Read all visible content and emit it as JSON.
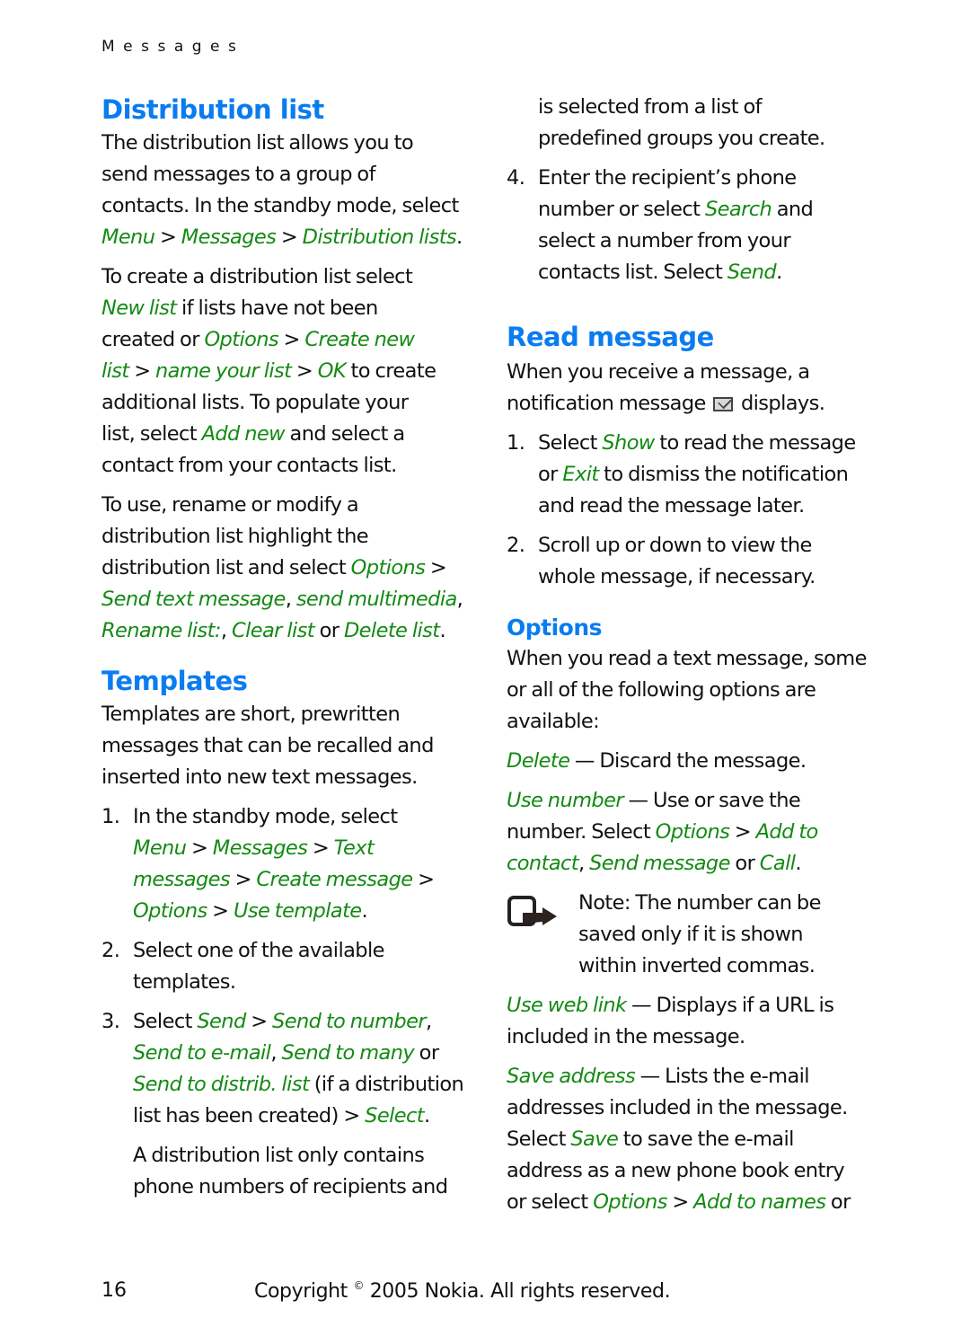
{
  "running_head": "Messages",
  "left_column": {
    "distribution_list": {
      "heading": "Distribution list",
      "para1": [
        [
          {
            "t": "The distribution list allows you to"
          }
        ],
        [
          {
            "t": "send messages to a group of"
          }
        ],
        [
          {
            "t": "contacts. In the standby mode, select"
          }
        ],
        [
          {
            "t": "Menu",
            "g": true
          },
          {
            "t": " > "
          },
          {
            "t": "Messages",
            "g": true
          },
          {
            "t": " > "
          },
          {
            "t": "Distribution lists",
            "g": true
          },
          {
            "t": "."
          }
        ]
      ],
      "para2": [
        [
          {
            "t": "To create a distribution list select"
          }
        ],
        [
          {
            "t": "New list",
            "g": true
          },
          {
            "t": " if lists have not been"
          }
        ],
        [
          {
            "t": "created or "
          },
          {
            "t": "Options",
            "g": true
          },
          {
            "t": " > "
          },
          {
            "t": "Create new",
            "g": true
          }
        ],
        [
          {
            "t": "list",
            "g": true
          },
          {
            "t": " > "
          },
          {
            "t": "name your list",
            "g": true
          },
          {
            "t": " > "
          },
          {
            "t": "OK",
            "g": true
          },
          {
            "t": " to create"
          }
        ],
        [
          {
            "t": "additional lists. To populate your"
          }
        ],
        [
          {
            "t": "list, select "
          },
          {
            "t": "Add new",
            "g": true
          },
          {
            "t": " and select a"
          }
        ],
        [
          {
            "t": "contact from your contacts list."
          }
        ]
      ],
      "para3": [
        [
          {
            "t": "To use, rename or modify a"
          }
        ],
        [
          {
            "t": "distribution list highlight the"
          }
        ],
        [
          {
            "t": "distribution list and select "
          },
          {
            "t": "Options",
            "g": true
          },
          {
            "t": " >"
          }
        ],
        [
          {
            "t": "Send text message",
            "g": true
          },
          {
            "t": ", "
          },
          {
            "t": "send multimedia",
            "g": true
          },
          {
            "t": ","
          }
        ],
        [
          {
            "t": "Rename list:",
            "g": true
          },
          {
            "t": ", "
          },
          {
            "t": "Clear list",
            "g": true
          },
          {
            "t": " or "
          },
          {
            "t": "Delete list",
            "g": true
          },
          {
            "t": "."
          }
        ]
      ]
    },
    "templates": {
      "heading": "Templates",
      "intro": [
        [
          {
            "t": "Templates are short, prewritten"
          }
        ],
        [
          {
            "t": "messages that can be recalled and"
          }
        ],
        [
          {
            "t": "inserted into new text messages."
          }
        ]
      ],
      "steps": [
        {
          "num": "1.",
          "lines": [
            [
              {
                "t": "In the standby mode, select"
              }
            ],
            [
              {
                "t": "Menu",
                "g": true
              },
              {
                "t": " > "
              },
              {
                "t": "Messages",
                "g": true
              },
              {
                "t": " > "
              },
              {
                "t": "Text",
                "g": true
              }
            ],
            [
              {
                "t": "messages",
                "g": true
              },
              {
                "t": " > "
              },
              {
                "t": "Create message",
                "g": true
              },
              {
                "t": " >"
              }
            ],
            [
              {
                "t": "Options",
                "g": true
              },
              {
                "t": " > "
              },
              {
                "t": "Use template",
                "g": true
              },
              {
                "t": "."
              }
            ]
          ]
        },
        {
          "num": "2.",
          "lines": [
            [
              {
                "t": "Select one of the available"
              }
            ],
            [
              {
                "t": "templates."
              }
            ]
          ]
        },
        {
          "num": "3.",
          "lines": [
            [
              {
                "t": "Select "
              },
              {
                "t": "Send",
                "g": true
              },
              {
                "t": " > "
              },
              {
                "t": "Send to number",
                "g": true
              },
              {
                "t": ","
              }
            ],
            [
              {
                "t": "Send to e-mail",
                "g": true
              },
              {
                "t": ", "
              },
              {
                "t": "Send to many",
                "g": true
              },
              {
                "t": " or"
              }
            ],
            [
              {
                "t": "Send to distrib. list",
                "g": true
              },
              {
                "t": " (if a distribution"
              }
            ],
            [
              {
                "t": "list has been created) > "
              },
              {
                "t": "Select",
                "g": true
              },
              {
                "t": "."
              }
            ]
          ],
          "extra": [
            [
              {
                "t": "A distribution list only contains"
              }
            ],
            [
              {
                "t": "phone numbers of recipients and"
              }
            ]
          ]
        }
      ]
    }
  },
  "right_column": {
    "continuation": [
      [
        {
          "t": "is selected from a list of"
        }
      ],
      [
        {
          "t": "predefined groups you create."
        }
      ]
    ],
    "step4": {
      "num": "4.",
      "lines": [
        [
          {
            "t": "Enter the recipient’s phone"
          }
        ],
        [
          {
            "t": "number or select "
          },
          {
            "t": "Search",
            "g": true
          },
          {
            "t": " and"
          }
        ],
        [
          {
            "t": "select a number from your"
          }
        ],
        [
          {
            "t": "contacts list. Select "
          },
          {
            "t": "Send",
            "g": true
          },
          {
            "t": "."
          }
        ]
      ]
    },
    "read_message": {
      "heading": "Read message",
      "intro_line1": "When you receive a message, a",
      "intro_line2_before": "notification message",
      "intro_icon": "envelope-icon",
      "intro_line2_after": "displays.",
      "steps": [
        {
          "num": "1.",
          "lines": [
            [
              {
                "t": "Select "
              },
              {
                "t": "Show",
                "g": true
              },
              {
                "t": " to read the message"
              }
            ],
            [
              {
                "t": "or "
              },
              {
                "t": "Exit",
                "g": true
              },
              {
                "t": " to dismiss the notification"
              }
            ],
            [
              {
                "t": "and read the message later."
              }
            ]
          ]
        },
        {
          "num": "2.",
          "lines": [
            [
              {
                "t": "Scroll up or down to view the"
              }
            ],
            [
              {
                "t": "whole message, if necessary."
              }
            ]
          ]
        }
      ]
    },
    "options": {
      "heading": "Options",
      "intro": [
        [
          {
            "t": "When you read a text message, some"
          }
        ],
        [
          {
            "t": "or all of the following options are"
          }
        ],
        [
          {
            "t": "available:"
          }
        ]
      ],
      "entries": [
        [
          [
            {
              "t": "Delete",
              "g": true
            },
            {
              "t": " — Discard the message."
            }
          ]
        ],
        [
          [
            {
              "t": "Use number",
              "g": true
            },
            {
              "t": " — Use or save the"
            }
          ],
          [
            {
              "t": "number. Select "
            },
            {
              "t": "Options",
              "g": true
            },
            {
              "t": " > "
            },
            {
              "t": "Add to",
              "g": true
            }
          ],
          [
            {
              "t": "contact",
              "g": true
            },
            {
              "t": ", "
            },
            {
              "t": "Send message",
              "g": true
            },
            {
              "t": " or "
            },
            {
              "t": "Call",
              "g": true
            },
            {
              "t": "."
            }
          ]
        ]
      ],
      "note": {
        "icon": "note-hand-icon",
        "lines": [
          [
            {
              "t": "Note:",
              "b": true
            },
            {
              "t": " The number can be"
            }
          ],
          [
            {
              "t": "saved only if it is shown"
            }
          ],
          [
            {
              "t": "within inverted commas."
            }
          ]
        ]
      },
      "entries_after": [
        [
          [
            {
              "t": "Use web link",
              "g": true
            },
            {
              "t": " — Displays if a URL is"
            }
          ],
          [
            {
              "t": "included in the message."
            }
          ]
        ],
        [
          [
            {
              "t": "Save address",
              "g": true
            },
            {
              "t": " — Lists the e-mail"
            }
          ],
          [
            {
              "t": "addresses included in the message."
            }
          ],
          [
            {
              "t": "Select "
            },
            {
              "t": "Save",
              "g": true
            },
            {
              "t": " to save the e-mail"
            }
          ],
          [
            {
              "t": "address as a new phone book entry"
            }
          ],
          [
            {
              "t": "or select "
            },
            {
              "t": "Options",
              "g": true
            },
            {
              "t": " > "
            },
            {
              "t": "Add to names",
              "g": true
            },
            {
              "t": " or"
            }
          ]
        ]
      ]
    }
  },
  "footer": {
    "page_number": "16",
    "copyright_before": "Copyright",
    "copyright_symbol": "©",
    "copyright_after": "2005 Nokia. All rights reserved."
  },
  "colors": {
    "heading_blue": "#0a7cf0",
    "menu_green": "#138a13",
    "body_text": "#111111"
  }
}
